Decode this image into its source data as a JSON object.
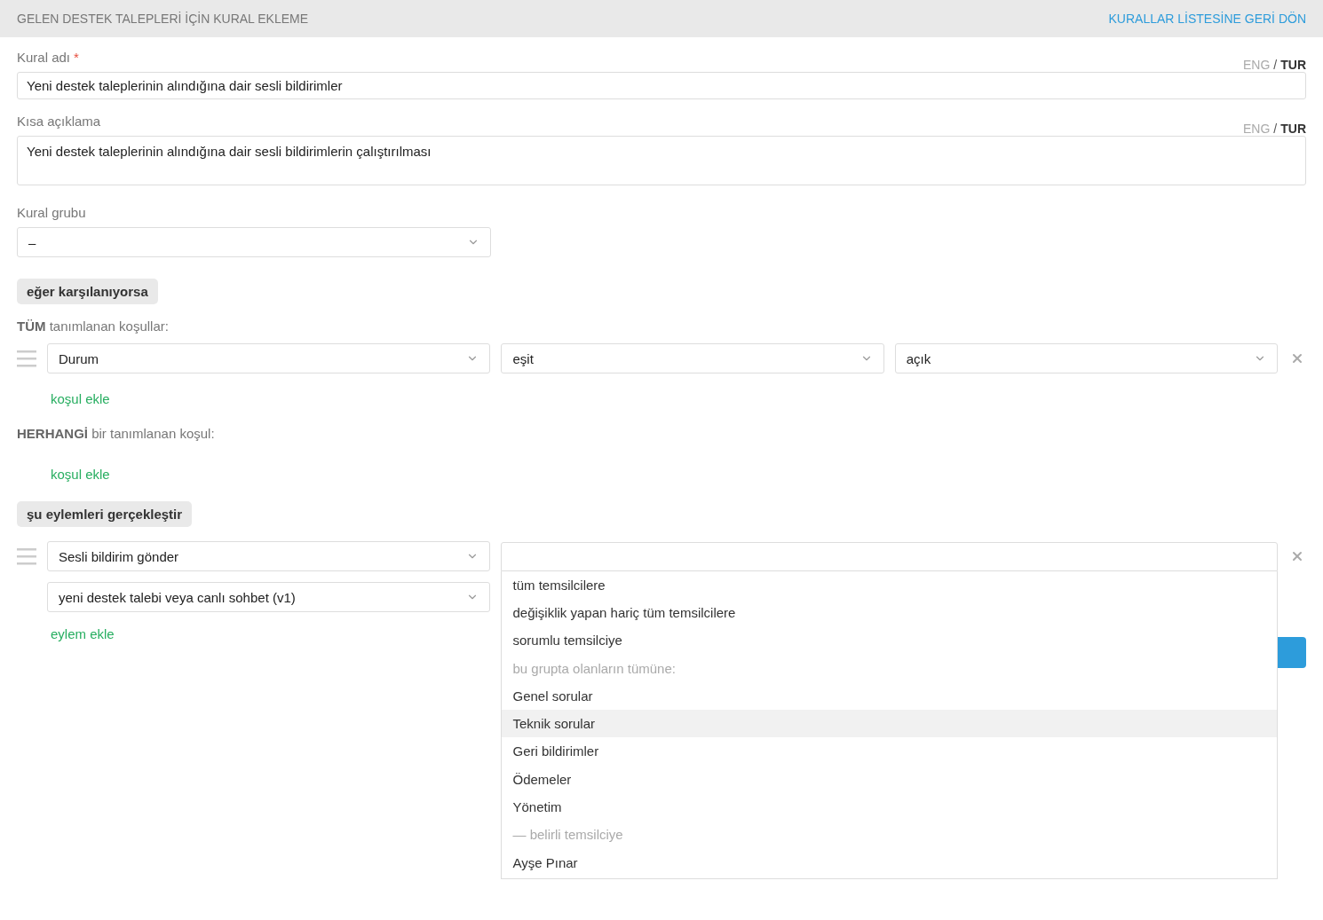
{
  "header": {
    "title": "GELEN DESTEK TALEPLERİ İÇİN KURAL EKLEME",
    "back_link": "KURALLAR LİSTESİNE GERİ DÖN"
  },
  "fields": [
    {
      "kind": "input",
      "label": "Kural adı",
      "required_mark": "*",
      "value": "Yeni destek taleplerinin alındığına dair sesli bildirimler",
      "separator": "/",
      "languages": [
        {
          "label": "ENG",
          "selected": false
        },
        {
          "label": "TUR",
          "selected": true
        }
      ]
    },
    {
      "kind": "textarea",
      "label": "Kısa açıklama",
      "value": "Yeni destek taleplerinin alındığına dair sesli bildirimlerin çalıştırılması",
      "separator": "/",
      "languages": [
        {
          "label": "ENG",
          "selected": false
        },
        {
          "label": "TUR",
          "selected": true
        }
      ]
    },
    {
      "kind": "select",
      "label": "Kural grubu",
      "value": "–"
    }
  ],
  "conditions": {
    "badge": "eğer karşılanıyorsa",
    "groups": [
      {
        "title": "**TÜM** tanımlanan koşullar:",
        "rows": [
          {
            "field": "Durum",
            "operator": "eşit",
            "value": "açık"
          }
        ],
        "add_link": "koşul ekle"
      },
      {
        "title": "**HERHANGİ** bir tanımlanan koşul:",
        "add_link": "koşul ekle"
      }
    ]
  },
  "actions": {
    "badge": "şu eylemleri gerçekleştir",
    "rows": [
      {
        "action": "Sesli bildirim gönder",
        "sound": "yeni destek talebi veya canlı sohbet (v1)",
        "target_value": "",
        "dropdown_open": true,
        "options": [
          {
            "kind": "option",
            "label": "tüm temsilcilere",
            "selected": false
          },
          {
            "kind": "option",
            "label": "değişiklik yapan hariç tüm temsilcilere",
            "selected": false
          },
          {
            "kind": "option",
            "label": "sorumlu temsilciye",
            "selected": false
          },
          {
            "kind": "group",
            "label": "bu grupta olanların tümüne:",
            "selected": false
          },
          {
            "kind": "option",
            "label": "Genel sorular",
            "selected": false
          },
          {
            "kind": "option",
            "label": "Teknik sorular",
            "selected": true
          },
          {
            "kind": "option",
            "label": "Geri bildirimler",
            "selected": false
          },
          {
            "kind": "option",
            "label": "Ödemeler",
            "selected": false
          },
          {
            "kind": "option",
            "label": "Yönetim",
            "selected": false
          },
          {
            "kind": "group",
            "label": "— belirli temsilciye",
            "selected": false
          },
          {
            "kind": "option",
            "label": "Ayşe Pınar",
            "selected": false
          }
        ]
      }
    ],
    "add_link": "eylem ekle"
  }
}
